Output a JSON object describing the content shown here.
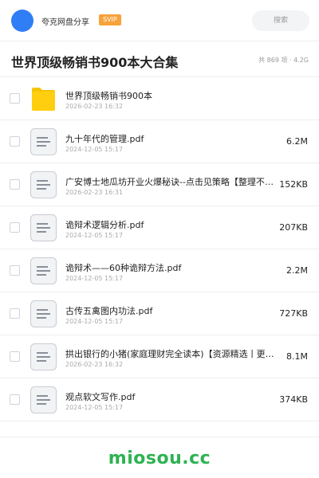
{
  "header": {
    "user_name": "夸克网盘分享",
    "badge": "SVIP",
    "search_placeholder": "搜索",
    "brand_color": "#2f7ef5",
    "badge_color": "#f7a23b"
  },
  "share": {
    "title": "世界顶级畅销书900本大合集",
    "meta": "共 869 项 · 4.2G"
  },
  "files": [
    {
      "name": "世界顶级畅销书900本",
      "date": "2026-02-23 16:32",
      "size": "",
      "icon": "folder-icon"
    },
    {
      "name": "九十年代的管理.pdf",
      "date": "2024-12-05 15:17",
      "size": "6.2M",
      "icon": "document-icon"
    },
    {
      "name": "广安博士地瓜坊开业火爆秘诀--点击见策略【整理不易…",
      "date": "2026-02-23 16:31",
      "size": "152KB",
      "icon": "document-icon"
    },
    {
      "name": "诡辩术逻辑分析.pdf",
      "date": "2024-12-05 15:17",
      "size": "207KB",
      "icon": "document-icon"
    },
    {
      "name": "诡辩术——60种诡辩方法.pdf",
      "date": "2024-12-05 15:17",
      "size": "2.2M",
      "icon": "document-icon"
    },
    {
      "name": "古传五禽图内功法.pdf",
      "date": "2024-12-05 15:17",
      "size": "727KB",
      "icon": "document-icon"
    },
    {
      "name": "拱出银行的小猪(家庭理财完全读本)【资源精选丨更多…",
      "date": "2026-02-23 16:32",
      "size": "8.1M",
      "icon": "document-icon"
    },
    {
      "name": "观点软文写作.pdf",
      "date": "2024-12-05 15:17",
      "size": "374KB",
      "icon": "document-icon"
    }
  ],
  "footer": {
    "watermark": "miosou.cc",
    "watermark_color": "#2eb252"
  }
}
